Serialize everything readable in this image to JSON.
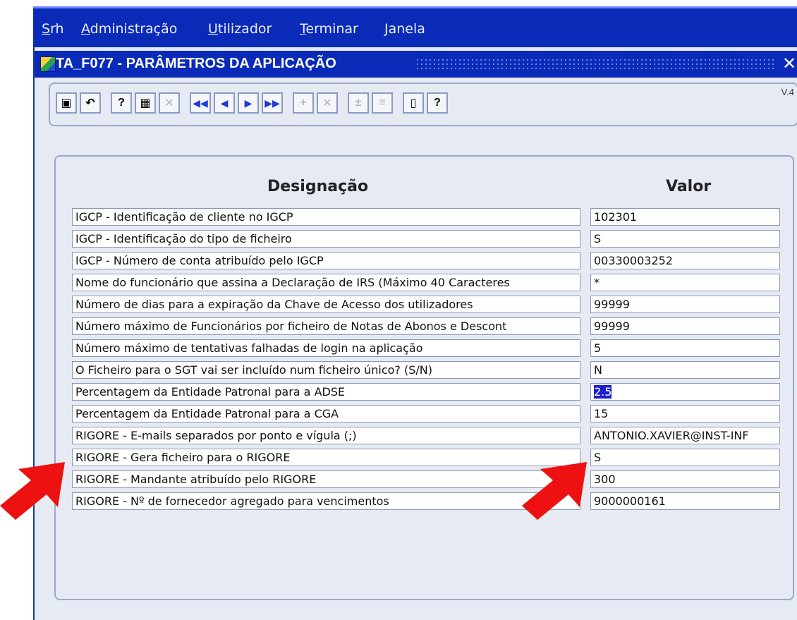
{
  "menu": [
    "Srh",
    "Administração",
    "Utilizador",
    "Terminar",
    "Janela"
  ],
  "window": {
    "title": "TA_F077 - PARÂMETROS DA APLICAÇÃO",
    "close": "✕"
  },
  "toolbar": {
    "version": "V.4",
    "buttons": [
      {
        "name": "save-icon",
        "glyph": "▣"
      },
      {
        "name": "undo-icon",
        "glyph": "↶"
      },
      {
        "name": "query-icon",
        "glyph": "?"
      },
      {
        "name": "execute-query-icon",
        "glyph": "▦"
      },
      {
        "name": "cancel-query-icon",
        "glyph": "✕"
      },
      {
        "name": "first-record-icon",
        "glyph": "◀◀"
      },
      {
        "name": "previous-record-icon",
        "glyph": "◀"
      },
      {
        "name": "next-record-icon",
        "glyph": "▶"
      },
      {
        "name": "last-record-icon",
        "glyph": "▶▶"
      },
      {
        "name": "insert-record-icon",
        "glyph": "+"
      },
      {
        "name": "delete-record-icon",
        "glyph": "✕"
      },
      {
        "name": "duplicate-record-icon",
        "glyph": "±"
      },
      {
        "name": "print-icon",
        "glyph": "≡"
      },
      {
        "name": "exit-icon",
        "glyph": "▯"
      },
      {
        "name": "help-icon",
        "glyph": "?"
      }
    ]
  },
  "table": {
    "header_designacao": "Designação",
    "header_valor": "Valor",
    "rows": [
      {
        "label": "IGCP - Identificação de cliente no IGCP",
        "value": "102301"
      },
      {
        "label": "IGCP - Identificação do tipo de ficheiro",
        "value": "S"
      },
      {
        "label": "IGCP - Número de conta atribuído pelo IGCP",
        "value": "00330003252"
      },
      {
        "label": "Nome do funcionário que assina a Declaração de IRS (Máximo 40 Caracteres",
        "value": "*"
      },
      {
        "label": "Número de dias para a expiração da Chave de Acesso dos utilizadores",
        "value": "99999"
      },
      {
        "label": "Número máximo de Funcionários por ficheiro de Notas de Abonos e Descont",
        "value": "99999"
      },
      {
        "label": "Número máximo de tentativas falhadas de login na aplicação",
        "value": "5"
      },
      {
        "label": "O Ficheiro para o SGT vai ser incluído num ficheiro único? (S/N)",
        "value": "N"
      },
      {
        "label": "Percentagem da Entidade Patronal para a ADSE",
        "value": "2.5"
      },
      {
        "label": "Percentagem da Entidade Patronal para a CGA",
        "value": "15"
      },
      {
        "label": "RIGORE - E-mails separados por ponto e vígula (;)",
        "value": "ANTONIO.XAVIER@INST-INF"
      },
      {
        "label": "RIGORE - Gera ficheiro para o RIGORE",
        "value": "S"
      },
      {
        "label": "RIGORE - Mandante atribuído pelo RIGORE",
        "value": "300"
      },
      {
        "label": "RIGORE - Nº de fornecedor agregado para vencimentos",
        "value": "9000000161"
      }
    ],
    "selected_row": 8
  },
  "colors": {
    "arrow": "#ee1111",
    "selection": "#1c1cd2",
    "menubar": "#0a2bb8"
  }
}
